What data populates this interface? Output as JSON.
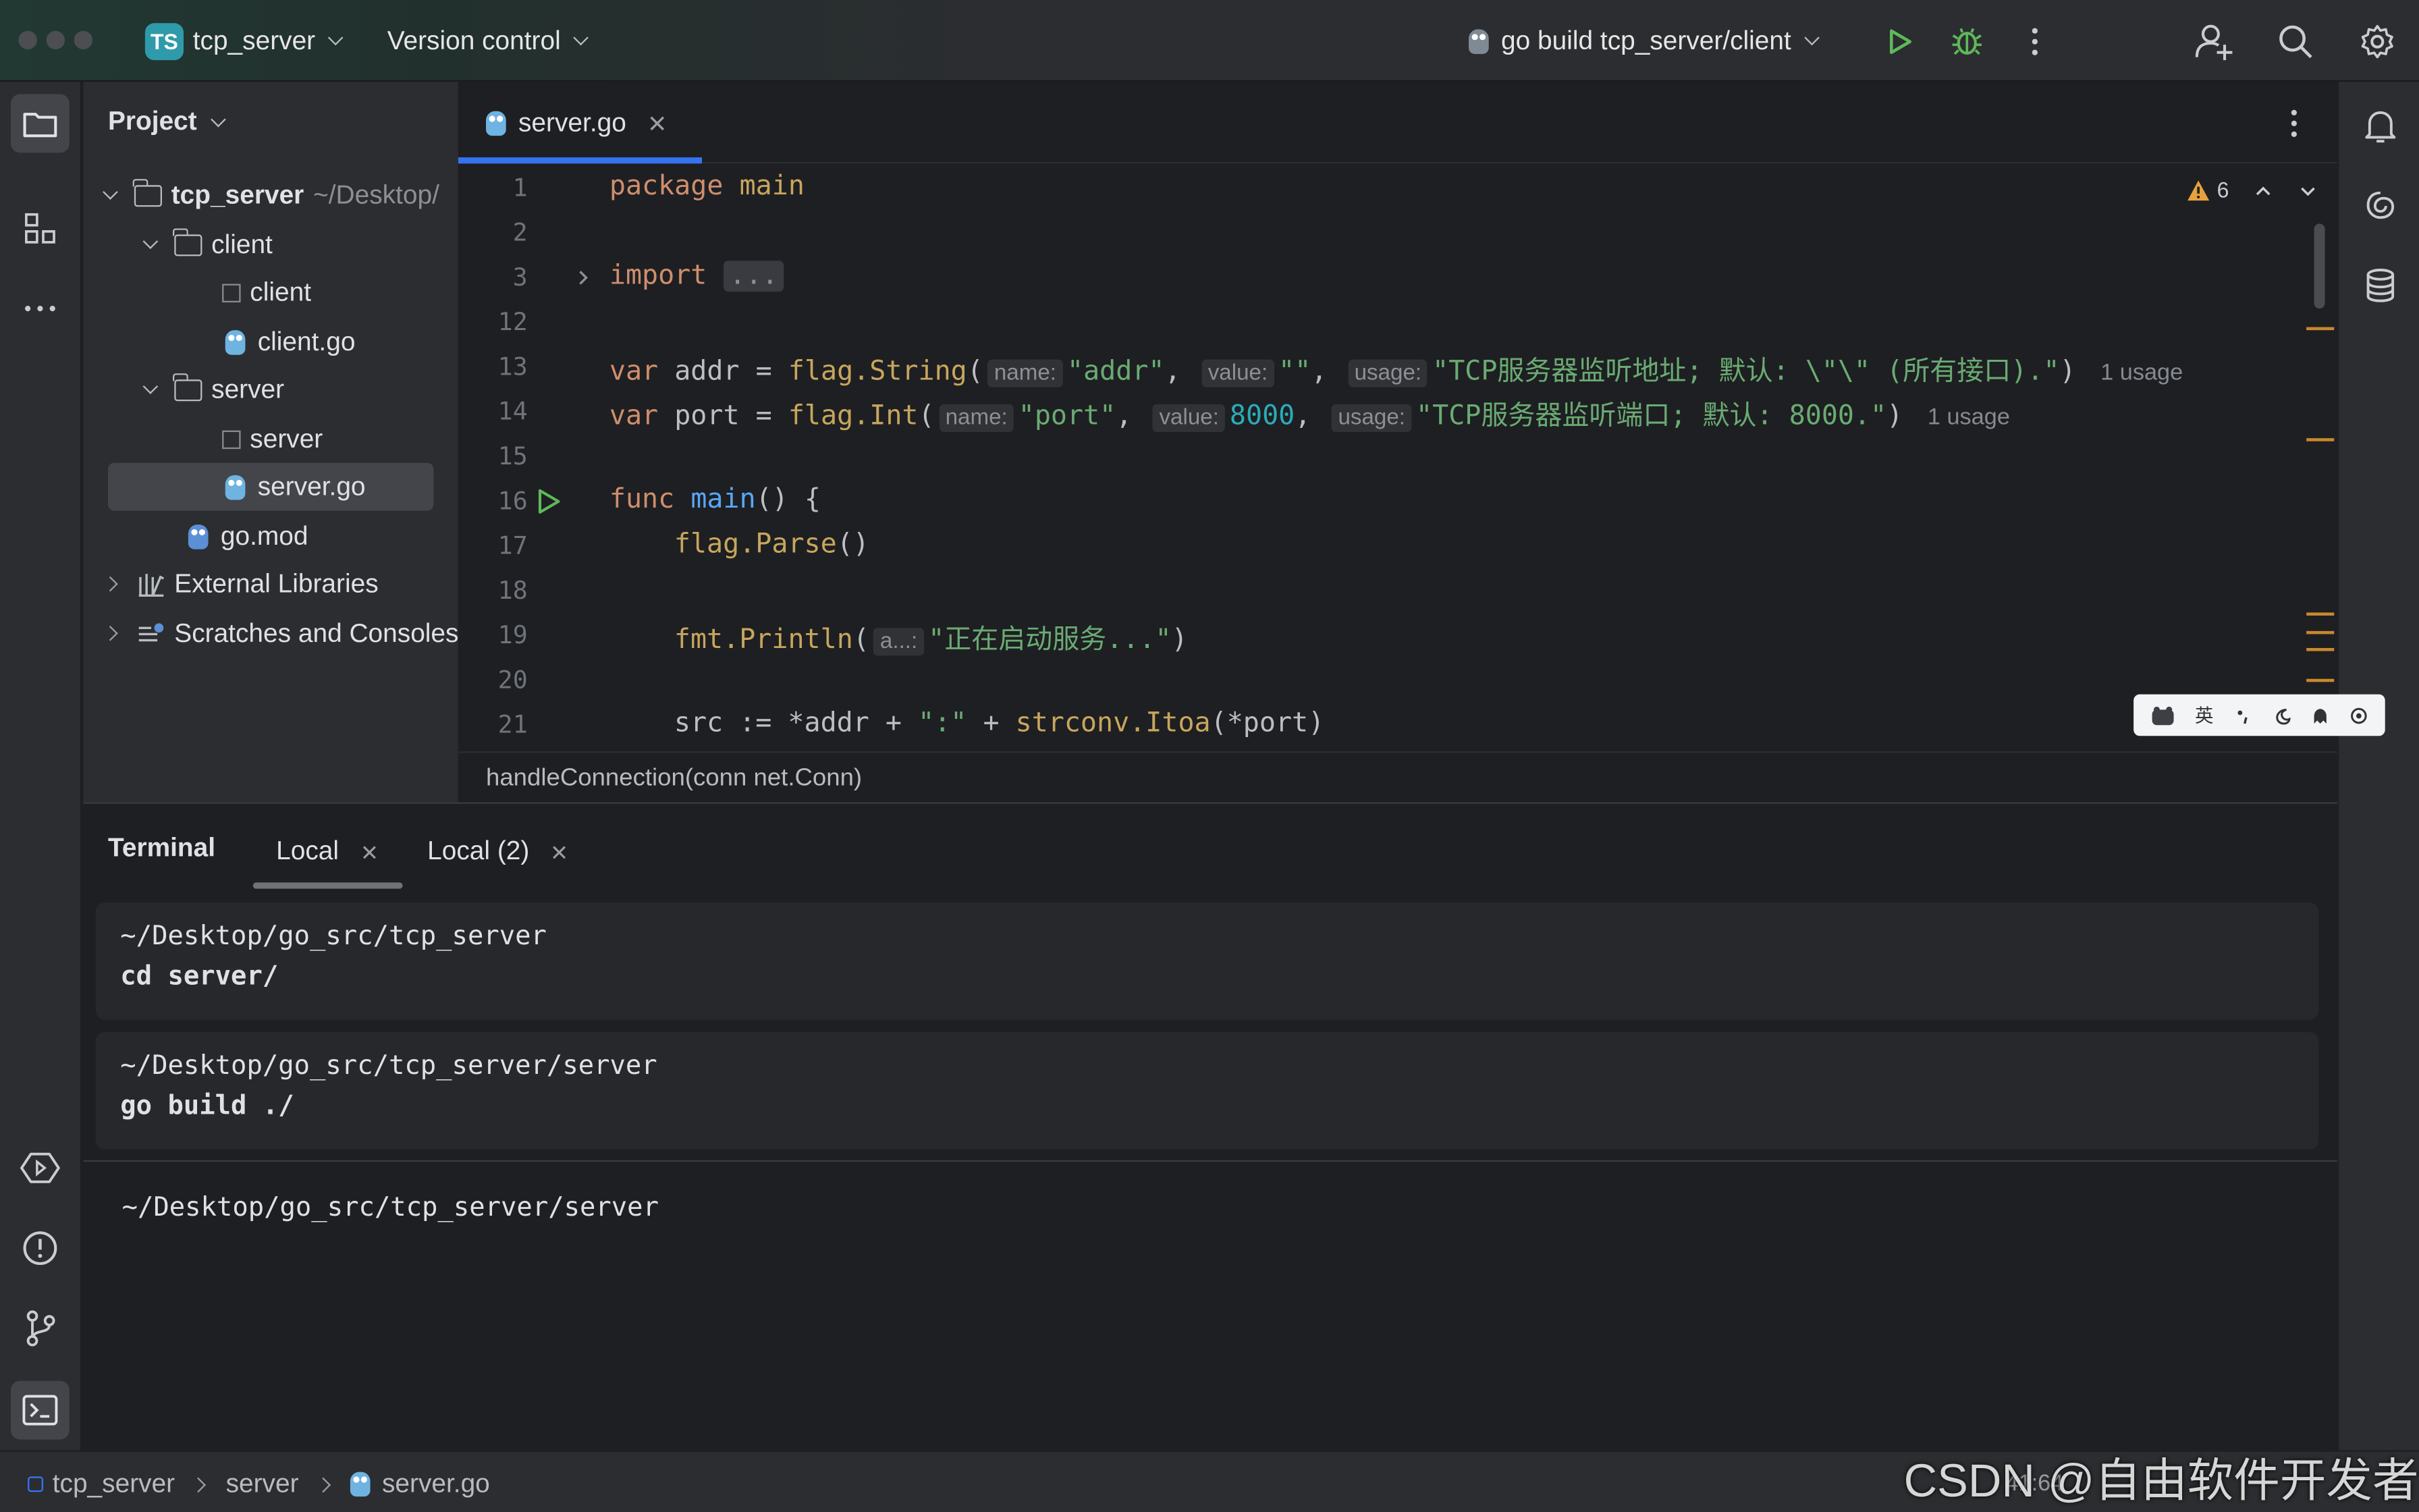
{
  "titlebar": {
    "project_badge": "TS",
    "project_name": "tcp_server",
    "version_control": "Version control",
    "run_config": "go build tcp_server/client"
  },
  "project_panel": {
    "title": "Project",
    "tree": [
      {
        "label": "tcp_server",
        "suffix": "~/Desktop/"
      },
      {
        "label": "client"
      },
      {
        "label": "client"
      },
      {
        "label": "client.go"
      },
      {
        "label": "server"
      },
      {
        "label": "server"
      },
      {
        "label": "server.go",
        "selected": true
      },
      {
        "label": "go.mod"
      },
      {
        "label": "External Libraries"
      },
      {
        "label": "Scratches and Consoles"
      }
    ]
  },
  "editor": {
    "tab_label": "server.go",
    "warning_count": "6",
    "line_numbers": [
      "1",
      "2",
      "3",
      "12",
      "13",
      "14",
      "15",
      "16",
      "17",
      "18",
      "19",
      "20",
      "21"
    ],
    "lines": {
      "l1_kw": "package",
      "l1_name": "main",
      "l3_kw": "import",
      "l3_fold": "...",
      "l13_var": "var",
      "l13_name": "addr",
      "l13_eq": " = ",
      "l13_pkg": "flag.",
      "l13_fn": "String",
      "l13_open": "(",
      "l13_h1": "name:",
      "l13_s1": "\"addr\"",
      "l13_comma1": ",",
      "l13_h2": "value:",
      "l13_s2": "\"\"",
      "l13_comma2": ",",
      "l13_h3": "usage:",
      "l13_s3": "\"TCP服务器监听地址; 默认: \\\"\\\" (所有接口).\"",
      "l13_close": ")",
      "l13_usage": "1 usage",
      "l14_var": "var",
      "l14_name": "port",
      "l14_eq": " = ",
      "l14_pkg": "flag.",
      "l14_fn": "Int",
      "l14_open": "(",
      "l14_h1": "name:",
      "l14_s1": "\"port\"",
      "l14_comma1": ",",
      "l14_h2": "value:",
      "l14_n2": "8000",
      "l14_comma2": ",",
      "l14_h3": "usage:",
      "l14_s3": "\"TCP服务器监听端口; 默认: 8000.\"",
      "l14_close": ")",
      "l14_usage": "1 usage",
      "l16_kw": "func",
      "l16_fn": "main",
      "l16_rest": "() {",
      "l17_pkg": "flag.",
      "l17_fn": "Parse",
      "l17_rest": "()",
      "l19_pkg": "fmt.",
      "l19_fn": "Println",
      "l19_open": "(",
      "l19_h1": "a...:",
      "l19_s1": "\"正在启动服务...\"",
      "l19_close": ")",
      "l21_a": "src := *addr + ",
      "l21_s": "\":\"",
      "l21_b": " + ",
      "l21_pkg": "strconv.",
      "l21_fn": "Itoa",
      "l21_c": "(*port)"
    },
    "breadcrumb": "handleConnection(conn net.Conn)"
  },
  "ime_toolbar": {
    "lang": "英"
  },
  "terminal": {
    "title": "Terminal",
    "tabs": [
      {
        "label": "Local",
        "active": true
      },
      {
        "label": "Local (2)",
        "active": false
      }
    ],
    "blocks": [
      {
        "path": "~/Desktop/go_src/tcp_server",
        "cmd": "cd server/"
      },
      {
        "path": "~/Desktop/go_src/tcp_server/server",
        "cmd": "go build ./"
      }
    ],
    "prompt": "~/Desktop/go_src/tcp_server/server"
  },
  "statusbar": {
    "crumbs": [
      "tcp_server",
      "server",
      "server.go"
    ],
    "position": "41:64"
  },
  "watermark": "CSDN @自由软件开发者",
  "colors": {
    "accent": "#3574f0",
    "keyword": "#cf8e6d",
    "function": "#56a8f5",
    "string": "#6aab73",
    "number": "#2aacb8",
    "warning": "#e6a23c",
    "run_green": "#5fb85a"
  }
}
